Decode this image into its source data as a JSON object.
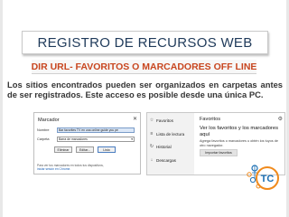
{
  "slide": {
    "title": "REGISTRO DE RECURSOS WEB",
    "subtitle": "DIR URL- FAVORITOS O MARCADORES OFF LINE",
    "body": "Los sitios encontrados pueden ser organizados en carpetas antes de ser registrados. Este acceso es posible desde una única PC."
  },
  "dialog": {
    "title": "Marcador",
    "close_icon": "close-icon",
    "name_label": "Nombre",
    "name_value": "Bar favorites TV en una online guide you pe",
    "folder_label": "Carpeta",
    "folder_value": "Barra de marcadores",
    "buttons": {
      "remove": "Eliminar",
      "edit": "Editar...",
      "done": "Listo"
    },
    "footer_line1": "Para ver tus marcadores en todos tus dispositivos,",
    "footer_link": "iniciar sesión en Chrome."
  },
  "hub": {
    "nav": [
      {
        "icon": "star-icon",
        "label": "Favoritos"
      },
      {
        "icon": "reading-list-icon",
        "label": "Lista de lectura"
      },
      {
        "icon": "history-icon",
        "label": "Historial"
      },
      {
        "icon": "download-icon",
        "label": "Descargas"
      }
    ],
    "panel_title": "Favoritos",
    "heading": "Ver los favoritos y los marcadores aquí",
    "description": "Agrega favoritos o marcadores u obtén los tuyos de otro navegador.",
    "import_button": "Importar favoritos",
    "settings_icon": "gear-icon"
  },
  "logo": {
    "text": "TC",
    "colors": {
      "primary": "#1c6fb3",
      "accent": "#f08a1c"
    }
  },
  "colors": {
    "title": "#1f3a5a",
    "subtitle": "#c8461f",
    "body": "#353535"
  }
}
